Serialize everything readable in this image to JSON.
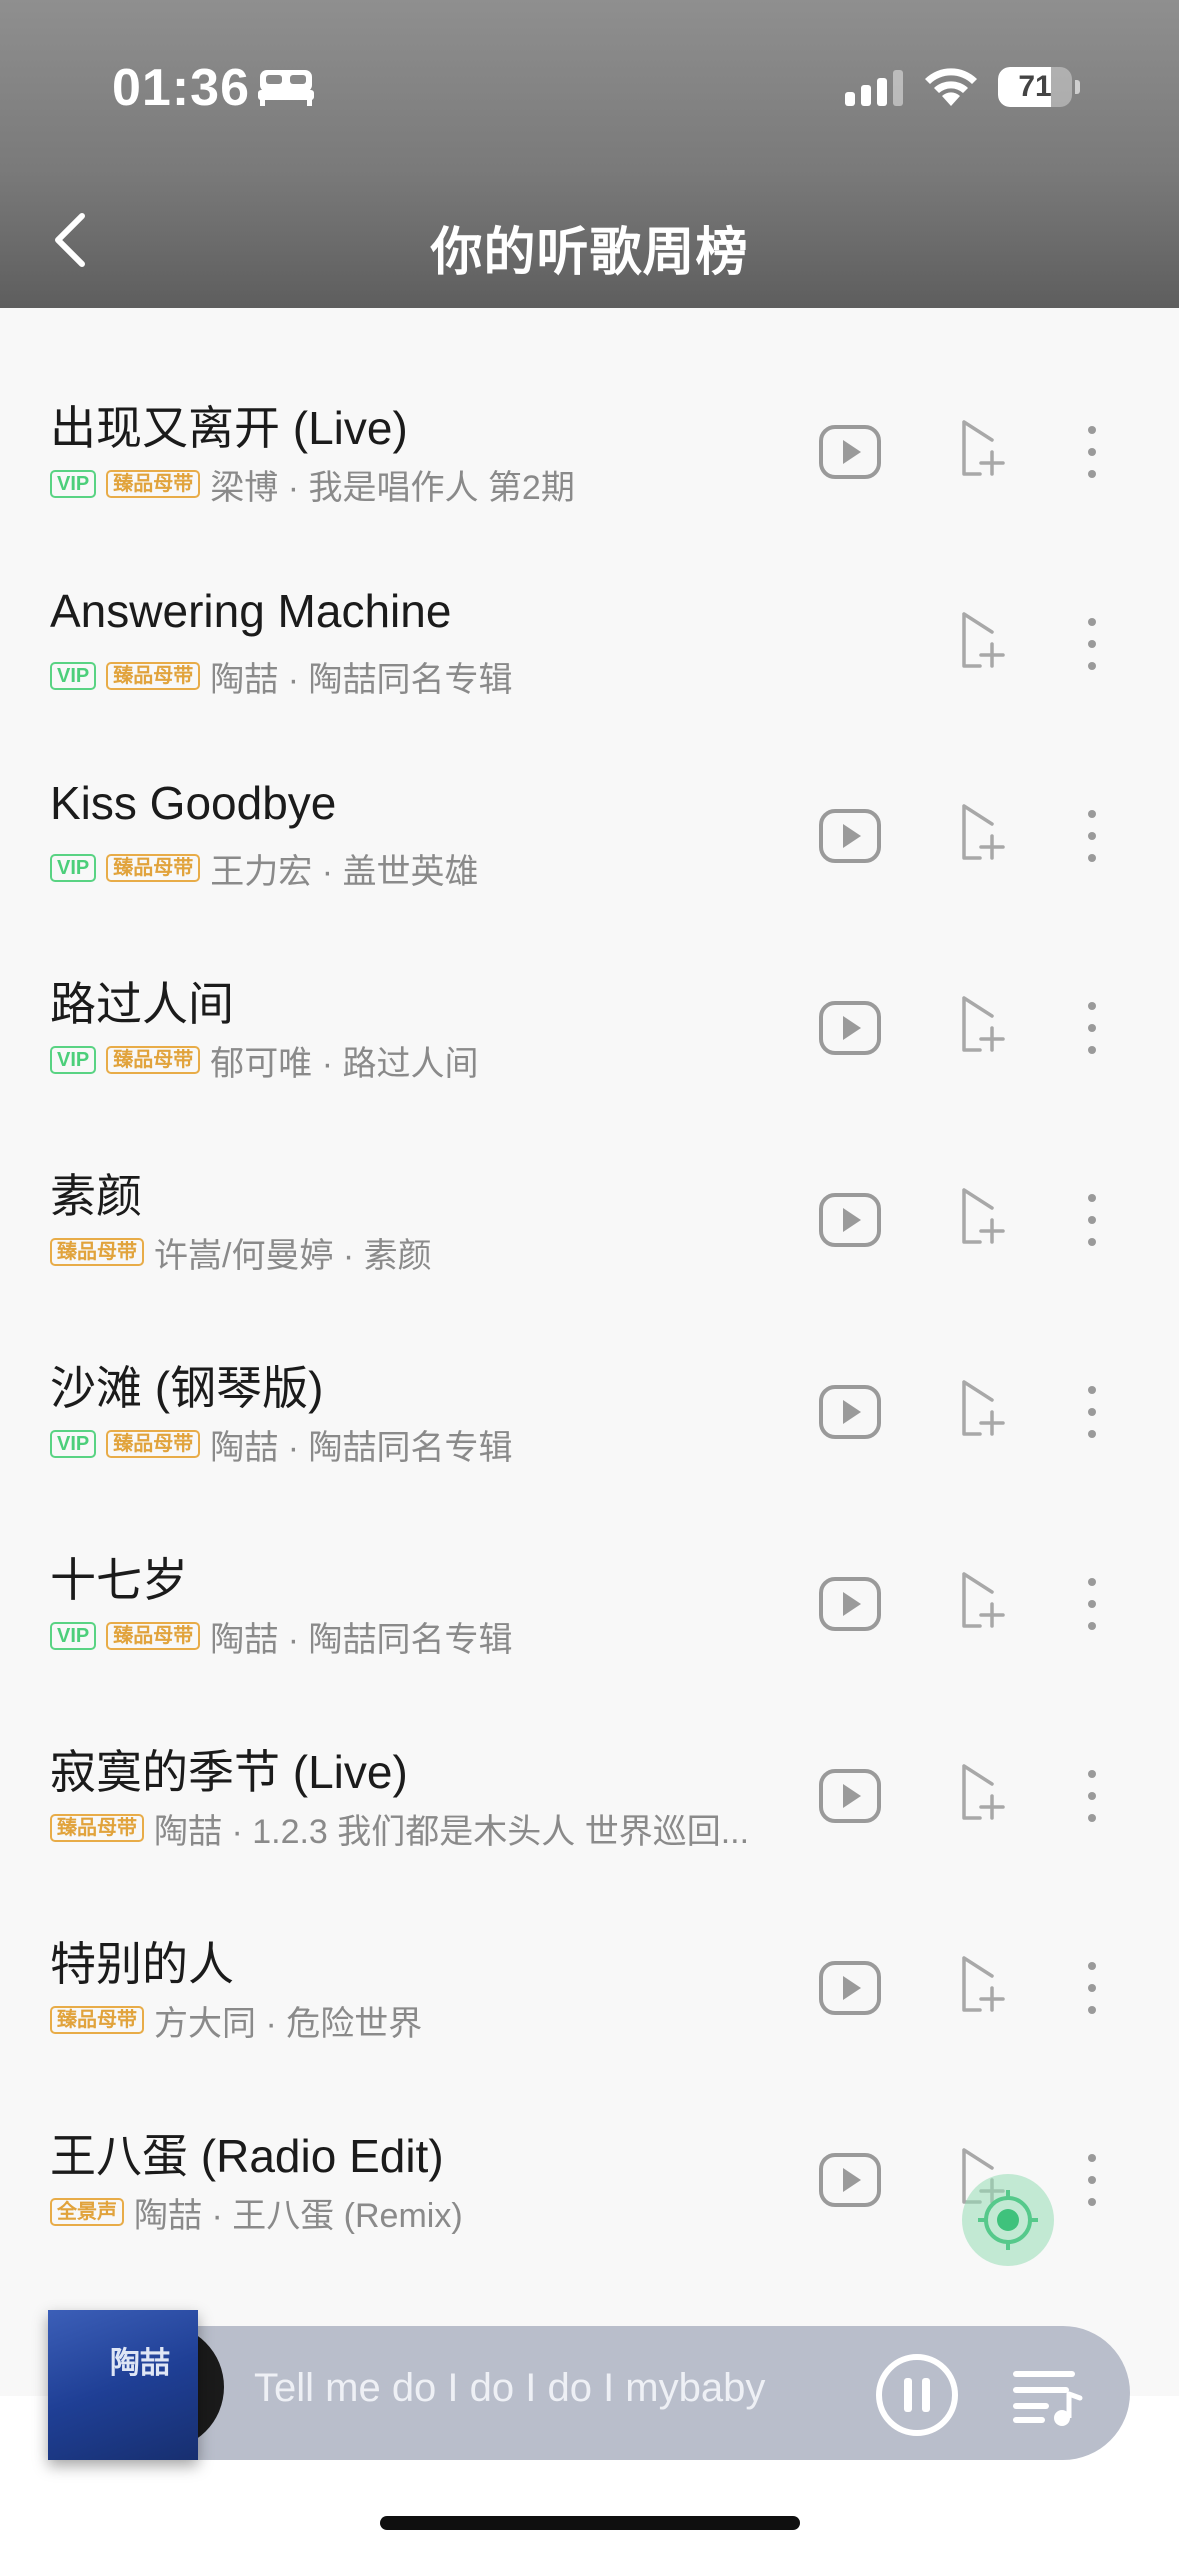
{
  "status_bar": {
    "time": "01:36",
    "battery": "71",
    "battery_level": 0.71
  },
  "header": {
    "title": "你的听歌周榜"
  },
  "songs": [
    {
      "title": "出现又离开 (Live)",
      "vip": true,
      "badge": "臻品母带",
      "meta": "梁博 · 我是唱作人 第2期",
      "has_play": true
    },
    {
      "title": "Answering Machine",
      "vip": true,
      "badge": "臻品母带",
      "meta": "陶喆 · 陶喆同名专辑",
      "has_play": false
    },
    {
      "title": "Kiss Goodbye",
      "vip": true,
      "badge": "臻品母带",
      "meta": "王力宏 · 盖世英雄",
      "has_play": true
    },
    {
      "title": "路过人间",
      "vip": true,
      "badge": "臻品母带",
      "meta": "郁可唯 · 路过人间",
      "has_play": true
    },
    {
      "title": "素颜",
      "vip": false,
      "badge": "臻品母带",
      "meta": "许嵩/何曼婷 · 素颜",
      "has_play": true
    },
    {
      "title": "沙滩 (钢琴版)",
      "vip": true,
      "badge": "臻品母带",
      "meta": "陶喆 · 陶喆同名专辑",
      "has_play": true
    },
    {
      "title": "十七岁",
      "vip": true,
      "badge": "臻品母带",
      "meta": "陶喆 · 陶喆同名专辑",
      "has_play": true
    },
    {
      "title": "寂寞的季节 (Live)",
      "vip": false,
      "badge": "臻品母带",
      "meta": "陶喆 · 1.2.3 我们都是木头人 世界巡回...",
      "has_play": true
    },
    {
      "title": "特别的人",
      "vip": false,
      "badge": "臻品母带",
      "meta": "方大同 · 危险世界",
      "has_play": true
    },
    {
      "title": "王八蛋 (Radio Edit)",
      "vip": false,
      "badge": "全景声",
      "meta": "陶喆 · 王八蛋 (Remix)",
      "has_play": true
    }
  ],
  "badges": {
    "vip": "VIP"
  },
  "player": {
    "lyric": "Tell me do I do I do I mybaby",
    "album_text": "陶喆"
  },
  "colors": {
    "vip_green": "#4ccf7a",
    "gold": "#e1a33c",
    "header_gray": "#7a7a7a",
    "player_bar": "#b9becb"
  },
  "icons": [
    "bed-icon",
    "signal-icon",
    "wifi-icon",
    "back-chevron-icon",
    "play-video-icon",
    "add-to-playlist-icon",
    "more-vertical-icon",
    "pause-icon",
    "playlist-icon",
    "locate-icon"
  ]
}
